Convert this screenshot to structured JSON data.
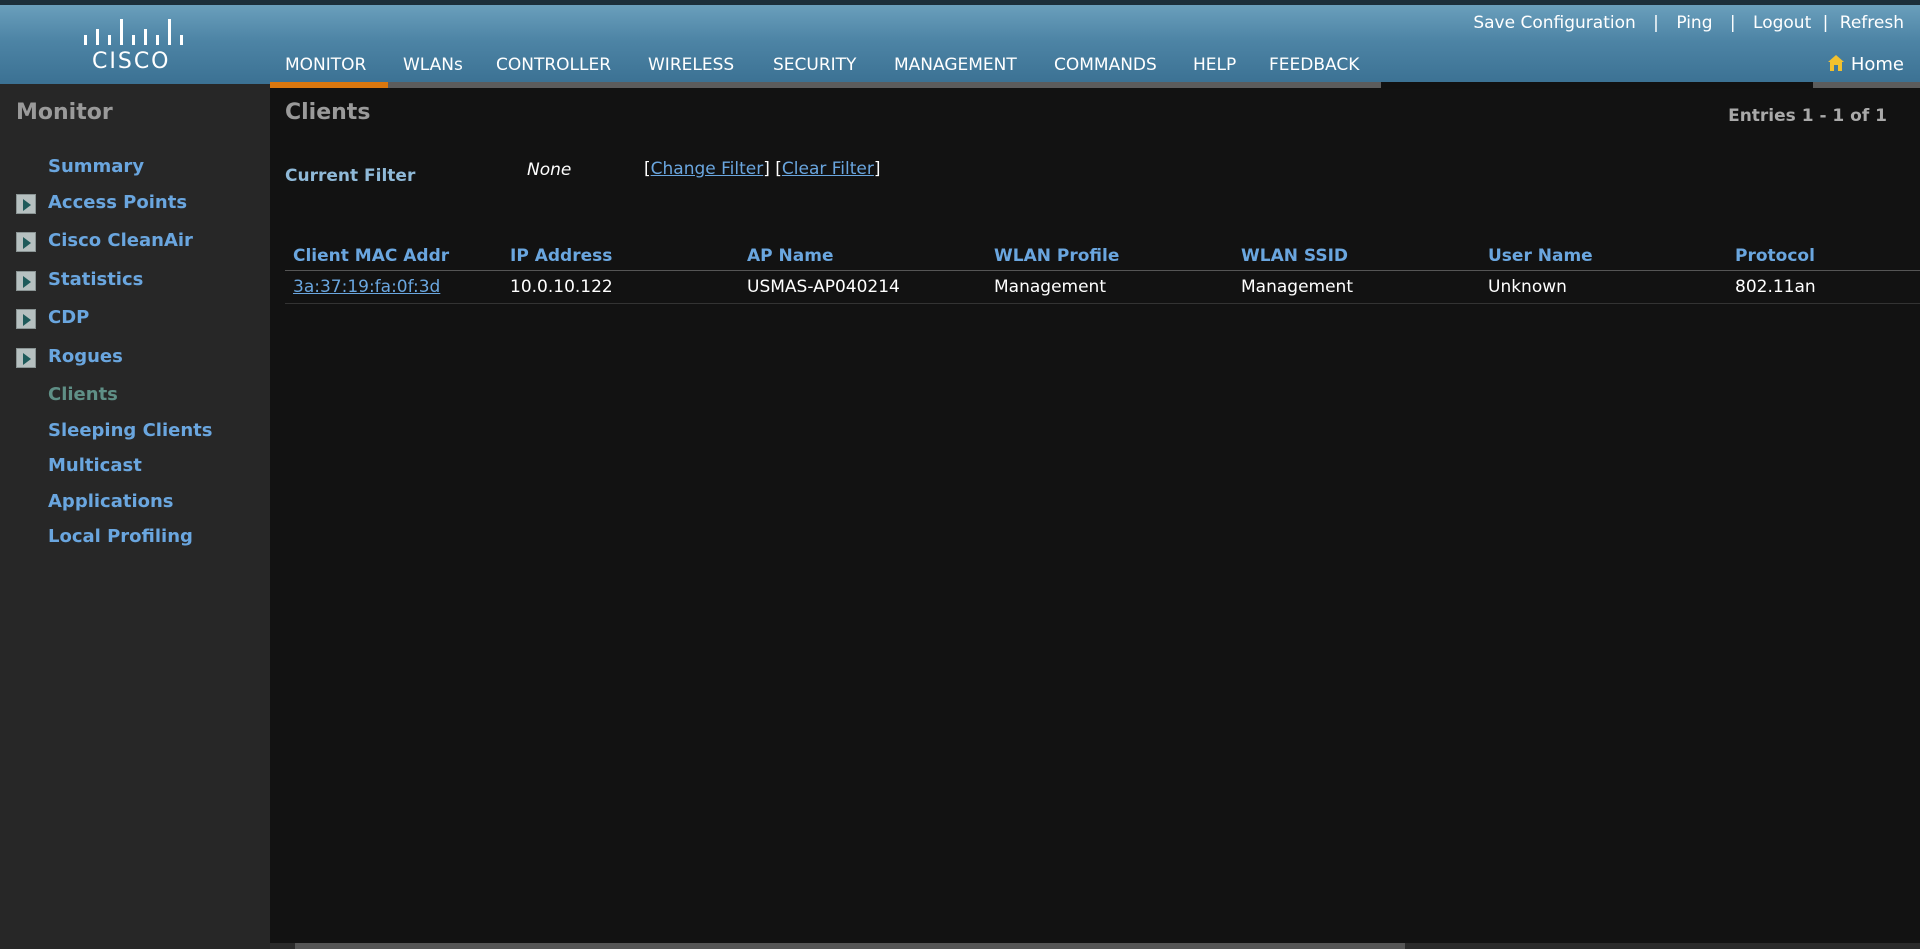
{
  "header": {
    "logo_text": "CISCO",
    "top_links": [
      "Save Configuration",
      "Ping",
      "Logout",
      "Refresh"
    ],
    "nav": [
      "MONITOR",
      "WLANs",
      "CONTROLLER",
      "WIRELESS",
      "SECURITY",
      "MANAGEMENT",
      "COMMANDS",
      "HELP",
      "FEEDBACK"
    ],
    "home_label": "Home",
    "accent_color": "#d9770f"
  },
  "sidebar": {
    "title": "Monitor",
    "items": [
      {
        "label": "Summary"
      },
      {
        "label": "Access Points"
      },
      {
        "label": "Cisco CleanAir"
      },
      {
        "label": "Statistics"
      },
      {
        "label": "CDP"
      },
      {
        "label": "Rogues"
      },
      {
        "label": "Clients"
      },
      {
        "label": "Sleeping Clients"
      },
      {
        "label": "Multicast"
      },
      {
        "label": "Applications"
      },
      {
        "label": "Local Profiling"
      }
    ]
  },
  "main": {
    "title": "Clients",
    "entries": "Entries 1 - 1 of 1",
    "filter_label": "Current Filter",
    "filter_value": "None",
    "change_filter": "Change Filter",
    "clear_filter": "Clear Filter",
    "columns": [
      "Client MAC Addr",
      "IP Address",
      "AP Name",
      "WLAN Profile",
      "WLAN SSID",
      "User Name",
      "Protocol"
    ],
    "rows": [
      [
        "3a:37:19:fa:0f:3d",
        "10.0.10.122",
        "USMAS-AP040214",
        "Management",
        "Management",
        "Unknown",
        "802.11an"
      ]
    ]
  }
}
